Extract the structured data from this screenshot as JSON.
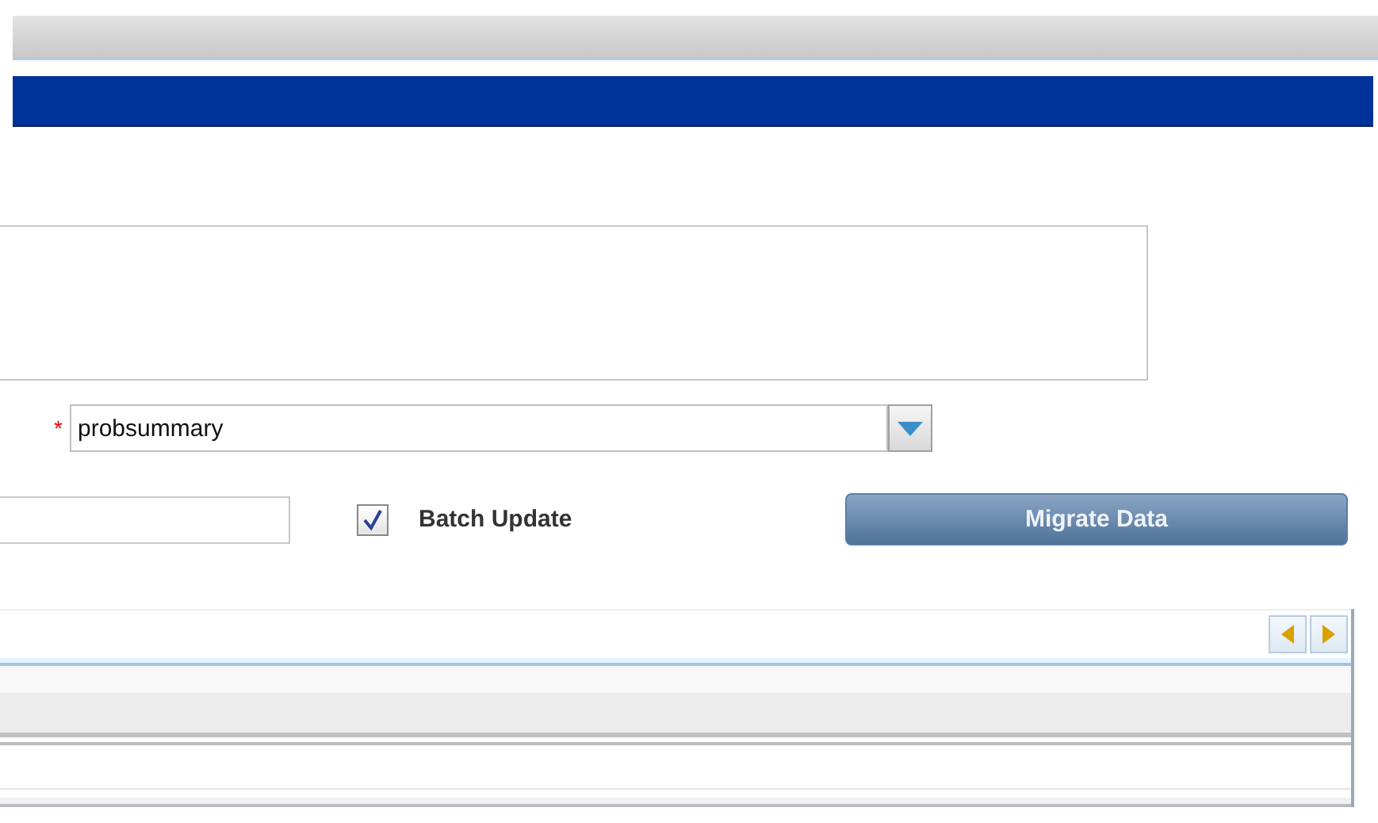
{
  "summary_field": {
    "required_marker": "*",
    "value": "probsummary"
  },
  "batch_update": {
    "label": "Batch Update",
    "checked": true
  },
  "migrate_button": {
    "label": "Migrate Data"
  }
}
